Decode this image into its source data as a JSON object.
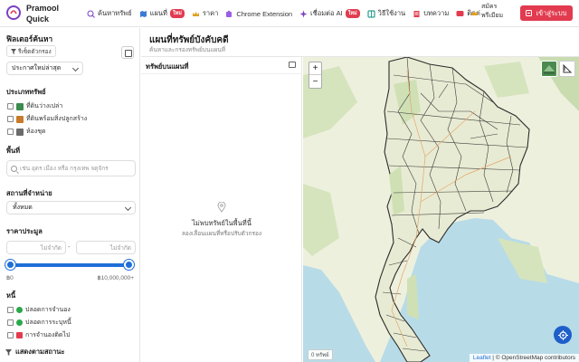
{
  "brand": {
    "name": "Pramool Quick"
  },
  "nav": [
    {
      "label": "ค้นหาทรัพย์",
      "icon": "search-icon"
    },
    {
      "label": "แผนที่",
      "icon": "map-icon",
      "badge": "ใหม่"
    },
    {
      "label": "ราคา",
      "icon": "crown-icon"
    },
    {
      "label": "Chrome Extension",
      "icon": "puzzle-icon"
    },
    {
      "label": "เชื่อมต่อ AI",
      "icon": "ai-icon",
      "badge": "ใหม่"
    },
    {
      "label": "วิธีใช้งาน",
      "icon": "book-icon"
    },
    {
      "label": "บทความ",
      "icon": "article-icon"
    },
    {
      "label": "ติดต่",
      "icon": "chat-icon"
    }
  ],
  "signup_label": "สมัครพรีเมียม",
  "login_label": "เข้าสู่ระบบ",
  "filters": {
    "title": "ฟิลเตอร์ค้นหา",
    "reset_label": "รีเซ็ตตัวกรอง",
    "sort_value": "ประกาศใหม่ล่าสุด",
    "property_type_heading": "ประเภททรัพย์",
    "property_types": [
      {
        "label": "ที่ดินว่างเปล่า",
        "color": "#3b8b4f"
      },
      {
        "label": "ที่ดินพร้อมสิ่งปลูกสร้าง",
        "color": "#c97a2b"
      },
      {
        "label": "ห้องชุด",
        "color": "#6b6b6b"
      }
    ],
    "area_heading": "พื้นที่",
    "area_placeholder": "เช่น อุดร เมือง หรือ กรุงเทพ จตุจักร",
    "sale_place_heading": "สถานที่จำหน่าย",
    "sale_place_value": "ทั้งหมด",
    "price_heading": "ราคาประมูล",
    "price_min_placeholder": "ไม่จำกัด",
    "price_max_placeholder": "ไม่จำกัด",
    "price_min_label": "฿0",
    "price_max_label": "฿10,000,000+",
    "debt_heading": "หนี้",
    "debt_options": [
      {
        "label": "ปลอดการจำนอง",
        "kind": "check"
      },
      {
        "label": "ปลอดการระบุหนี้",
        "kind": "check"
      },
      {
        "label": "การจำนองติดไป",
        "kind": "warn"
      }
    ],
    "show_status_label": "แสดงตามสถานะ"
  },
  "main": {
    "title": "แผนที่ทรัพย์บังคับคดี",
    "subtitle": "ค้นหาและกรองทรัพย์บนแผนที่",
    "list_title": "ทรัพย์บนแผนที่",
    "empty_title": "ไม่พบทรัพย์ในพื้นที่นี้",
    "empty_subtitle": "ลองเลื่อนแผนที่หรือปรับตัวกรอง"
  },
  "map": {
    "zoom_in": "+",
    "zoom_out": "−",
    "count_tag": "0 ทรัพย์",
    "attribution_leaflet": "Leaflet",
    "attribution_rest": "| © OpenStreetMap contributors",
    "colors": {
      "water": "#b8dbe8",
      "land": "#e9ecd9",
      "forest": "#c8dcb0",
      "border": "#3a3a3a"
    }
  },
  "colors": {
    "accent": "#e23b4f",
    "primary": "#1f6fd8"
  }
}
